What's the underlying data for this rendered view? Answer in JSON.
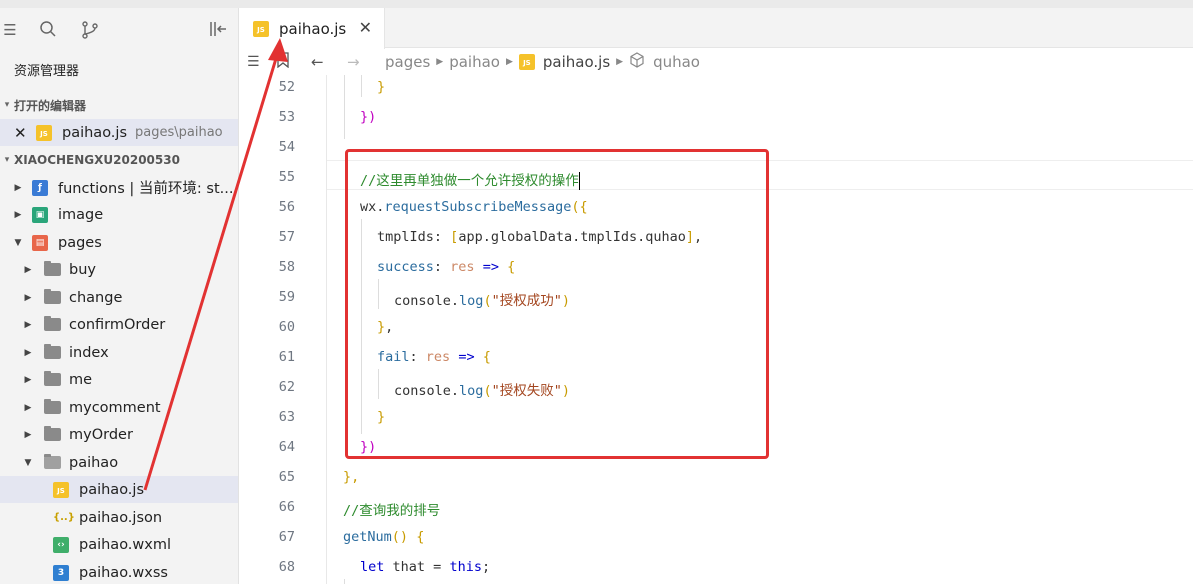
{
  "sidebar": {
    "title": "资源管理器",
    "open_editors_label": "打开的编辑器",
    "open_editor": {
      "name": "paihao.js",
      "path": "pages\\paihao"
    },
    "project_label": "XIAOCHENGXU20200530",
    "items": [
      {
        "label": "functions | 当前环境: st..."
      },
      {
        "label": "image"
      },
      {
        "label": "pages"
      },
      {
        "label": "buy"
      },
      {
        "label": "change"
      },
      {
        "label": "confirmOrder"
      },
      {
        "label": "index"
      },
      {
        "label": "me"
      },
      {
        "label": "mycomment"
      },
      {
        "label": "myOrder"
      },
      {
        "label": "paihao"
      },
      {
        "label": "paihao.js"
      },
      {
        "label": "paihao.json"
      },
      {
        "label": "paihao.wxml"
      },
      {
        "label": "paihao.wxss"
      }
    ]
  },
  "tab": {
    "label": "paihao.js",
    "close": "✕"
  },
  "breadcrumb": {
    "a": "pages",
    "b": "paihao",
    "c": "paihao.js",
    "d": "quhao"
  },
  "lines": {
    "n52": "52",
    "n53": "53",
    "n54": "54",
    "n55": "55",
    "n56": "56",
    "n57": "57",
    "n58": "58",
    "n59": "59",
    "n60": "60",
    "n61": "61",
    "n62": "62",
    "n63": "63",
    "n64": "64",
    "n65": "65",
    "n66": "66",
    "n67": "67",
    "n68": "68"
  },
  "code": {
    "l52": "}",
    "l53": "})",
    "l55": "//这里再单独做一个允许授权的操作",
    "l56_obj": "wx",
    "l56_fn": "requestSubscribeMessage",
    "l56_br": "({",
    "l57_key": "tmplIds",
    "l57_val": "app.globalData.tmplIds.quhao",
    "l58_key": "success",
    "l58_param": "res",
    "l58_arrow": "=>",
    "l59_obj": "console",
    "l59_fn": "log",
    "l59_str": "\"授权成功\"",
    "l61_key": "fail",
    "l61_param": "res",
    "l61_arrow": "=>",
    "l62_obj": "console",
    "l62_fn": "log",
    "l62_str": "\"授权失败\"",
    "l64": "})",
    "l65": "},",
    "l66": "//查询我的排号",
    "l67_fn": "getNum",
    "l68_kw": "let",
    "l68_var": "that",
    "l68_this": "this"
  },
  "colors": {
    "highlight_box": "#e23232",
    "arrow": "#e23232",
    "js_badge": "#f5c22a"
  }
}
